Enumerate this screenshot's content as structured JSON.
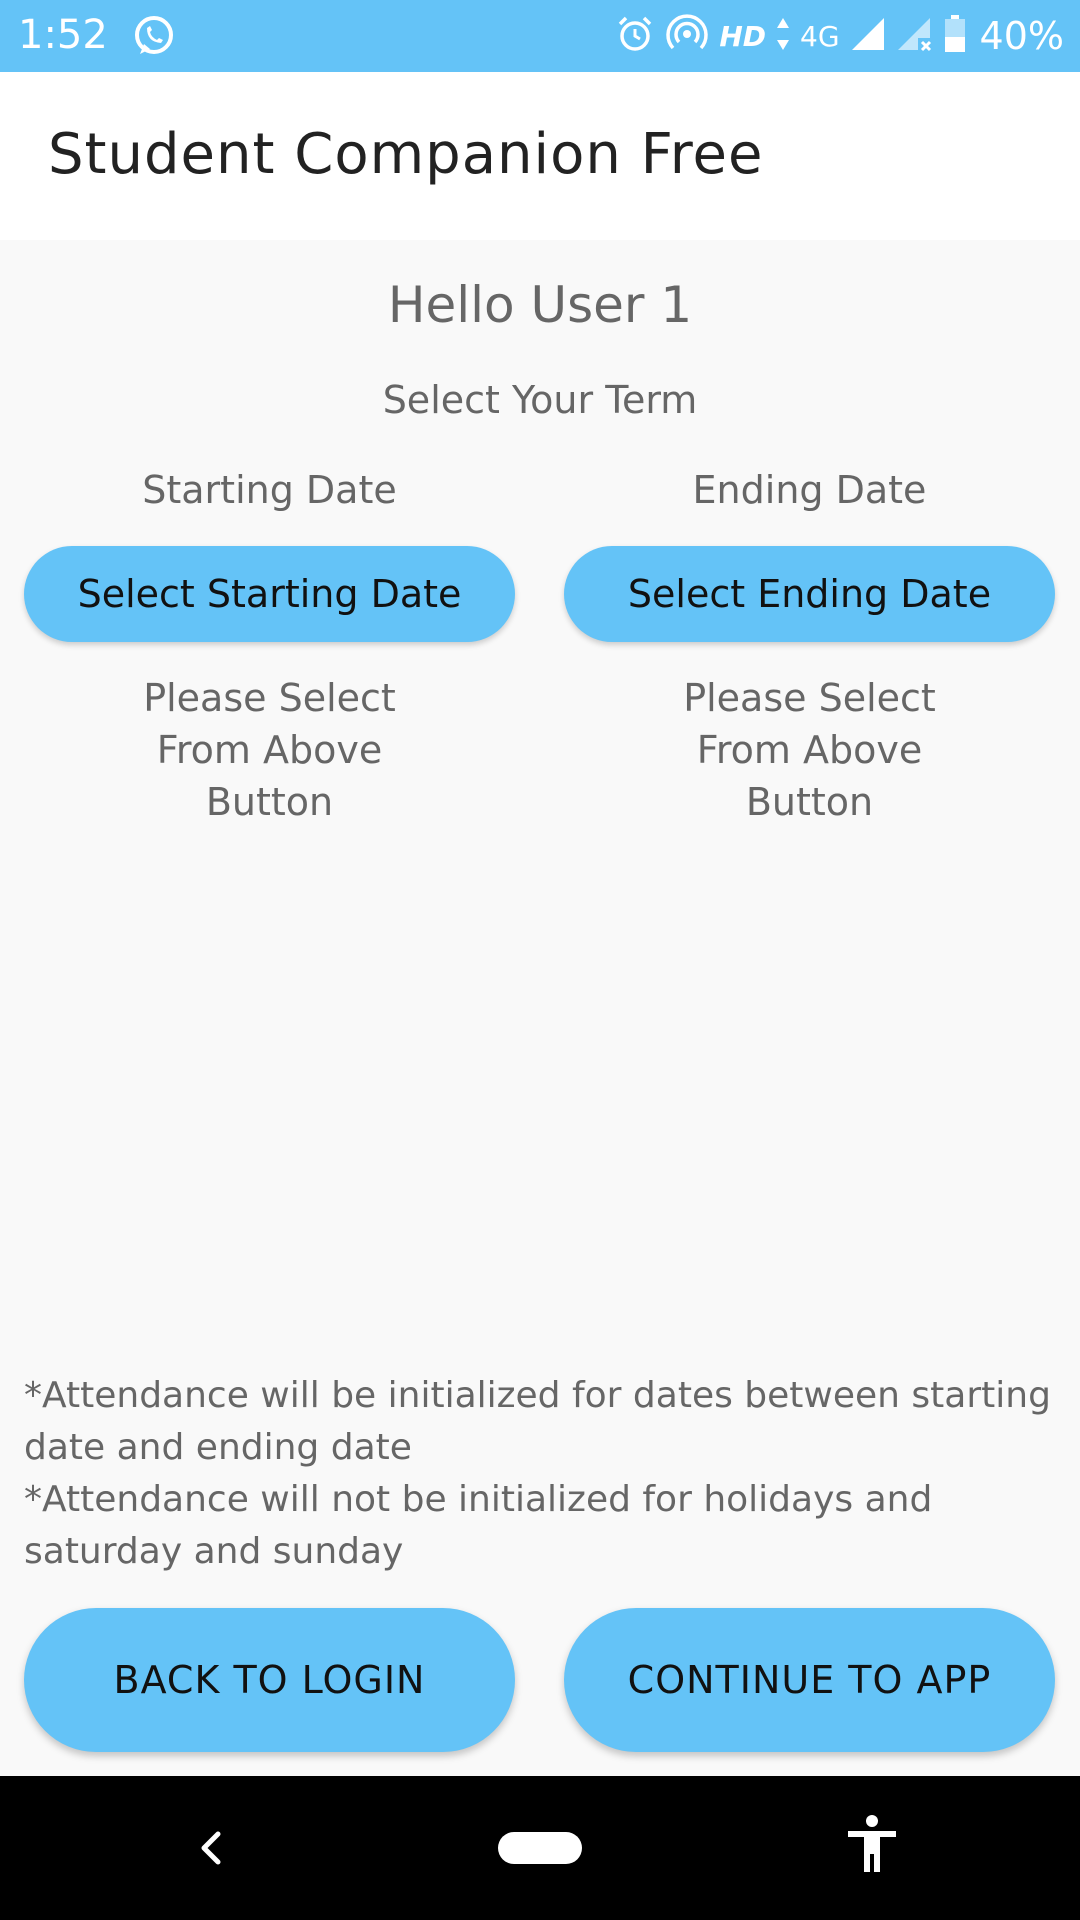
{
  "status_bar": {
    "time": "1:52",
    "hd": "HD",
    "network": "4G",
    "battery": "40%",
    "icons": [
      "whatsapp-icon",
      "alarm-icon",
      "hotspot-icon",
      "signal-icon",
      "signal-noservice-icon",
      "battery-icon"
    ]
  },
  "app_bar": {
    "title": "Student Companion Free"
  },
  "main": {
    "greeting": "Hello User 1",
    "term_label": "Select Your Term",
    "start": {
      "label": "Starting Date",
      "button": "Select Starting Date",
      "hint": "Please Select\nFrom Above\nButton"
    },
    "end": {
      "label": "Ending Date",
      "button": "Select Ending Date",
      "hint": "Please Select\nFrom Above\nButton"
    },
    "notes": [
      "*Attendance will be initialized for dates between starting date and ending date",
      "*Attendance will not be initialized for holidays and saturday and sunday"
    ]
  },
  "footer": {
    "back_label": "BACK TO LOGIN",
    "continue_label": "CONTINUE TO APP"
  },
  "colors": {
    "accent": "#64c3f7",
    "background": "#f9f9f9",
    "text": "#666666",
    "nav_bar": "#000000"
  }
}
